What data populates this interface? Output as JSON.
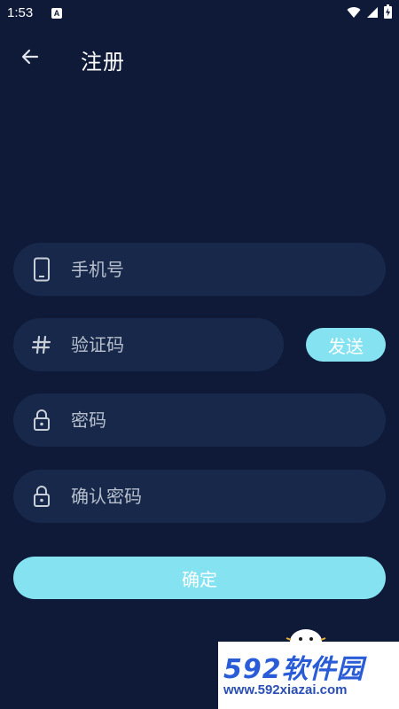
{
  "status_bar": {
    "time": "1:53",
    "notification_icon": "A"
  },
  "app_bar": {
    "title": "注册",
    "back_icon": "arrow-left-icon"
  },
  "form": {
    "phone": {
      "placeholder": "手机号",
      "value": "",
      "icon": "phone-icon"
    },
    "code": {
      "placeholder": "验证码",
      "value": "",
      "icon": "hash-icon"
    },
    "send_label": "发送",
    "password": {
      "placeholder": "密码",
      "value": "",
      "icon": "lock-icon"
    },
    "confirm_password": {
      "placeholder": "确认密码",
      "value": "",
      "icon": "lock-icon"
    },
    "confirm_label": "确定"
  },
  "colors": {
    "background": "#0e1a37",
    "field": "#17284a",
    "accent": "#84e2f1",
    "placeholder": "#b7bfcc"
  },
  "watermark": {
    "brand": "592软件园",
    "url": "www.592xiazai.com"
  }
}
